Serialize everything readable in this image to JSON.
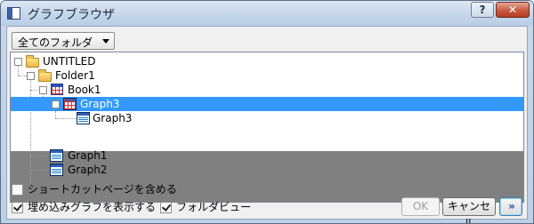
{
  "window": {
    "title": "グラフブラウザ",
    "help_label": "?",
    "close_label": "✕"
  },
  "folder_select": {
    "value": "全てのフォルダ"
  },
  "tree": {
    "nodes": [
      {
        "label": "UNTITLED",
        "icon": "folder-icon"
      },
      {
        "label": "Folder1",
        "icon": "folder-icon"
      },
      {
        "label": "Book1",
        "icon": "book-icon"
      },
      {
        "label": "Graph3",
        "icon": "graph-grid-icon",
        "selected": true
      },
      {
        "label": "Graph3",
        "icon": "graph-icon"
      },
      {
        "label": "Graph1",
        "icon": "graph-icon"
      },
      {
        "label": "Graph2",
        "icon": "graph-icon"
      }
    ]
  },
  "options": {
    "shortcut_label": "ショートカットページを含める",
    "shortcut_checked": false,
    "embedded_label": "埋め込みグラフを表示する",
    "embedded_checked": true,
    "folder_view_label": "フォルダビュー",
    "folder_view_checked": true
  },
  "buttons": {
    "ok": "OK",
    "cancel": "キャンセル",
    "expand": "»"
  },
  "colors": {
    "selection": "#3399ff",
    "tree_empty": "#808080"
  }
}
